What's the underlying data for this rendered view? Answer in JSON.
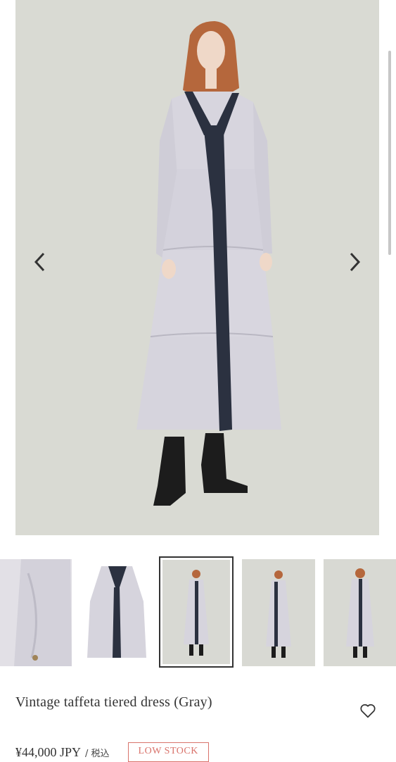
{
  "product": {
    "title": "Vintage taffeta tiered dress (Gray)",
    "price": "¥44,000 JPY",
    "tax_label": "/ 税込",
    "stock_badge": "LOW STOCK"
  },
  "gallery": {
    "thumbnail_count": 5,
    "active_index": 2
  },
  "colors": {
    "background": "#d9dad3",
    "dress": "#d6d4dd",
    "panel": "#2b3140",
    "badge": "#d9736b"
  },
  "icons": {
    "prev": "chevron-left-icon",
    "next": "chevron-right-icon",
    "wishlist": "heart-icon"
  }
}
